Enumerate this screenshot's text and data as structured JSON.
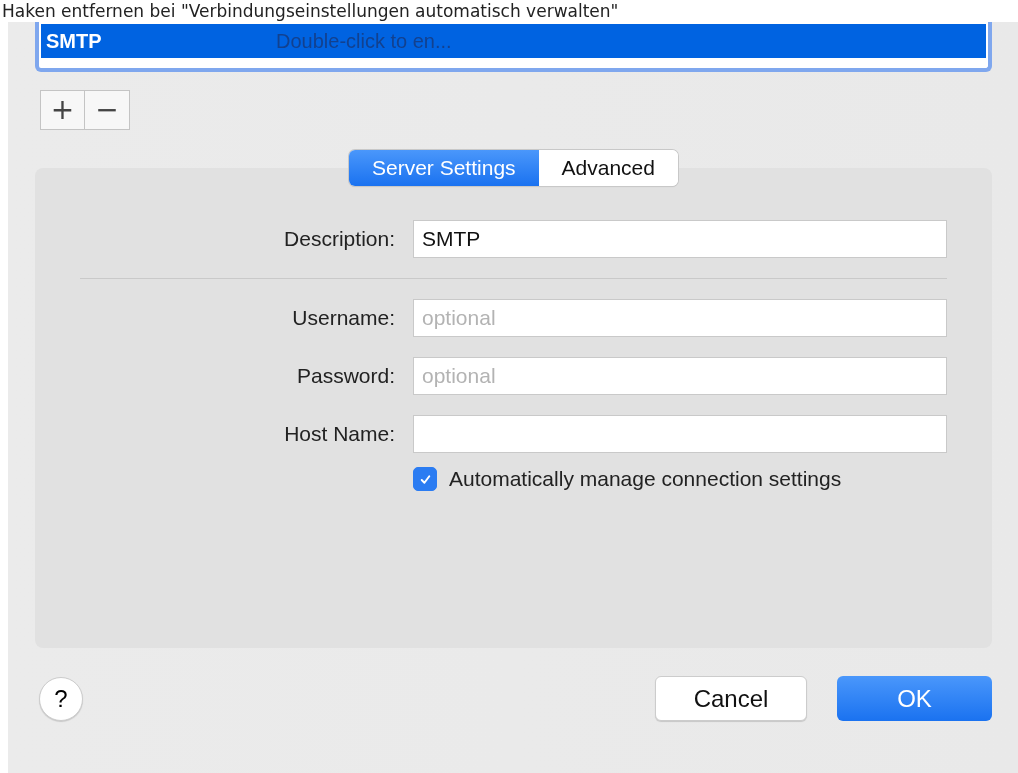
{
  "caption": "Haken entfernen bei \"Verbindungseinstellungen automatisch verwalten\"",
  "server_list": {
    "rows": [
      {
        "name": "SMTP",
        "hint": "Double-click to en...",
        "selected": true
      }
    ]
  },
  "list_buttons": [
    "+",
    "−"
  ],
  "tabs": [
    {
      "label": "Server Settings",
      "selected": true
    },
    {
      "label": "Advanced",
      "selected": false
    }
  ],
  "fields": [
    {
      "label": "Description:",
      "value": "SMTP"
    },
    {
      "label": "Username:",
      "placeholder": "optional"
    },
    {
      "label": "Password:",
      "placeholder": "optional"
    },
    {
      "label": "Host Name:"
    }
  ],
  "auto_manage": {
    "label": "Automatically manage connection settings",
    "checked": true
  },
  "help": "?",
  "buttons": [
    {
      "label": "Cancel",
      "kind": "secondary"
    },
    {
      "label": "OK",
      "kind": "primary"
    }
  ]
}
